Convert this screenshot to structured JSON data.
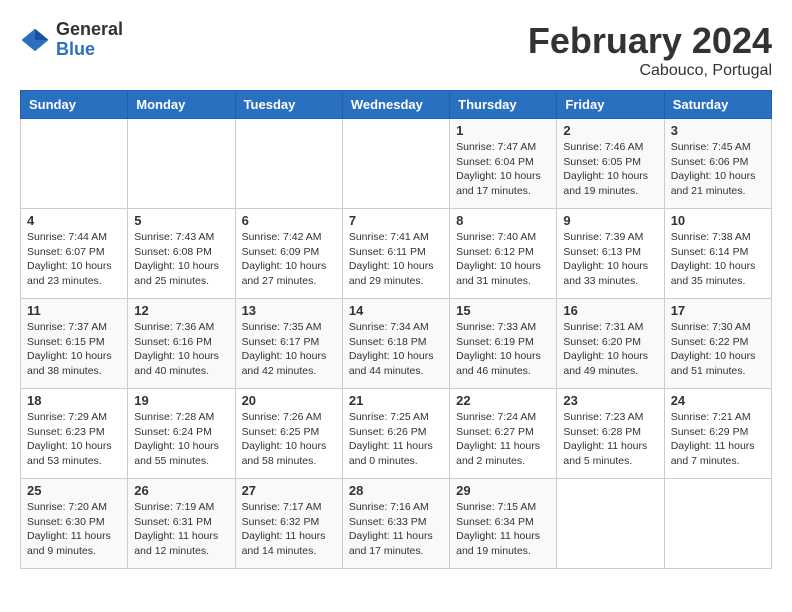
{
  "header": {
    "logo_general": "General",
    "logo_blue": "Blue",
    "title": "February 2024",
    "location": "Cabouco, Portugal"
  },
  "days_of_week": [
    "Sunday",
    "Monday",
    "Tuesday",
    "Wednesday",
    "Thursday",
    "Friday",
    "Saturday"
  ],
  "weeks": [
    {
      "days": [
        {
          "number": "",
          "info": ""
        },
        {
          "number": "",
          "info": ""
        },
        {
          "number": "",
          "info": ""
        },
        {
          "number": "",
          "info": ""
        },
        {
          "number": "1",
          "info": "Sunrise: 7:47 AM\nSunset: 6:04 PM\nDaylight: 10 hours\nand 17 minutes."
        },
        {
          "number": "2",
          "info": "Sunrise: 7:46 AM\nSunset: 6:05 PM\nDaylight: 10 hours\nand 19 minutes."
        },
        {
          "number": "3",
          "info": "Sunrise: 7:45 AM\nSunset: 6:06 PM\nDaylight: 10 hours\nand 21 minutes."
        }
      ]
    },
    {
      "days": [
        {
          "number": "4",
          "info": "Sunrise: 7:44 AM\nSunset: 6:07 PM\nDaylight: 10 hours\nand 23 minutes."
        },
        {
          "number": "5",
          "info": "Sunrise: 7:43 AM\nSunset: 6:08 PM\nDaylight: 10 hours\nand 25 minutes."
        },
        {
          "number": "6",
          "info": "Sunrise: 7:42 AM\nSunset: 6:09 PM\nDaylight: 10 hours\nand 27 minutes."
        },
        {
          "number": "7",
          "info": "Sunrise: 7:41 AM\nSunset: 6:11 PM\nDaylight: 10 hours\nand 29 minutes."
        },
        {
          "number": "8",
          "info": "Sunrise: 7:40 AM\nSunset: 6:12 PM\nDaylight: 10 hours\nand 31 minutes."
        },
        {
          "number": "9",
          "info": "Sunrise: 7:39 AM\nSunset: 6:13 PM\nDaylight: 10 hours\nand 33 minutes."
        },
        {
          "number": "10",
          "info": "Sunrise: 7:38 AM\nSunset: 6:14 PM\nDaylight: 10 hours\nand 35 minutes."
        }
      ]
    },
    {
      "days": [
        {
          "number": "11",
          "info": "Sunrise: 7:37 AM\nSunset: 6:15 PM\nDaylight: 10 hours\nand 38 minutes."
        },
        {
          "number": "12",
          "info": "Sunrise: 7:36 AM\nSunset: 6:16 PM\nDaylight: 10 hours\nand 40 minutes."
        },
        {
          "number": "13",
          "info": "Sunrise: 7:35 AM\nSunset: 6:17 PM\nDaylight: 10 hours\nand 42 minutes."
        },
        {
          "number": "14",
          "info": "Sunrise: 7:34 AM\nSunset: 6:18 PM\nDaylight: 10 hours\nand 44 minutes."
        },
        {
          "number": "15",
          "info": "Sunrise: 7:33 AM\nSunset: 6:19 PM\nDaylight: 10 hours\nand 46 minutes."
        },
        {
          "number": "16",
          "info": "Sunrise: 7:31 AM\nSunset: 6:20 PM\nDaylight: 10 hours\nand 49 minutes."
        },
        {
          "number": "17",
          "info": "Sunrise: 7:30 AM\nSunset: 6:22 PM\nDaylight: 10 hours\nand 51 minutes."
        }
      ]
    },
    {
      "days": [
        {
          "number": "18",
          "info": "Sunrise: 7:29 AM\nSunset: 6:23 PM\nDaylight: 10 hours\nand 53 minutes."
        },
        {
          "number": "19",
          "info": "Sunrise: 7:28 AM\nSunset: 6:24 PM\nDaylight: 10 hours\nand 55 minutes."
        },
        {
          "number": "20",
          "info": "Sunrise: 7:26 AM\nSunset: 6:25 PM\nDaylight: 10 hours\nand 58 minutes."
        },
        {
          "number": "21",
          "info": "Sunrise: 7:25 AM\nSunset: 6:26 PM\nDaylight: 11 hours\nand 0 minutes."
        },
        {
          "number": "22",
          "info": "Sunrise: 7:24 AM\nSunset: 6:27 PM\nDaylight: 11 hours\nand 2 minutes."
        },
        {
          "number": "23",
          "info": "Sunrise: 7:23 AM\nSunset: 6:28 PM\nDaylight: 11 hours\nand 5 minutes."
        },
        {
          "number": "24",
          "info": "Sunrise: 7:21 AM\nSunset: 6:29 PM\nDaylight: 11 hours\nand 7 minutes."
        }
      ]
    },
    {
      "days": [
        {
          "number": "25",
          "info": "Sunrise: 7:20 AM\nSunset: 6:30 PM\nDaylight: 11 hours\nand 9 minutes."
        },
        {
          "number": "26",
          "info": "Sunrise: 7:19 AM\nSunset: 6:31 PM\nDaylight: 11 hours\nand 12 minutes."
        },
        {
          "number": "27",
          "info": "Sunrise: 7:17 AM\nSunset: 6:32 PM\nDaylight: 11 hours\nand 14 minutes."
        },
        {
          "number": "28",
          "info": "Sunrise: 7:16 AM\nSunset: 6:33 PM\nDaylight: 11 hours\nand 17 minutes."
        },
        {
          "number": "29",
          "info": "Sunrise: 7:15 AM\nSunset: 6:34 PM\nDaylight: 11 hours\nand 19 minutes."
        },
        {
          "number": "",
          "info": ""
        },
        {
          "number": "",
          "info": ""
        }
      ]
    }
  ]
}
